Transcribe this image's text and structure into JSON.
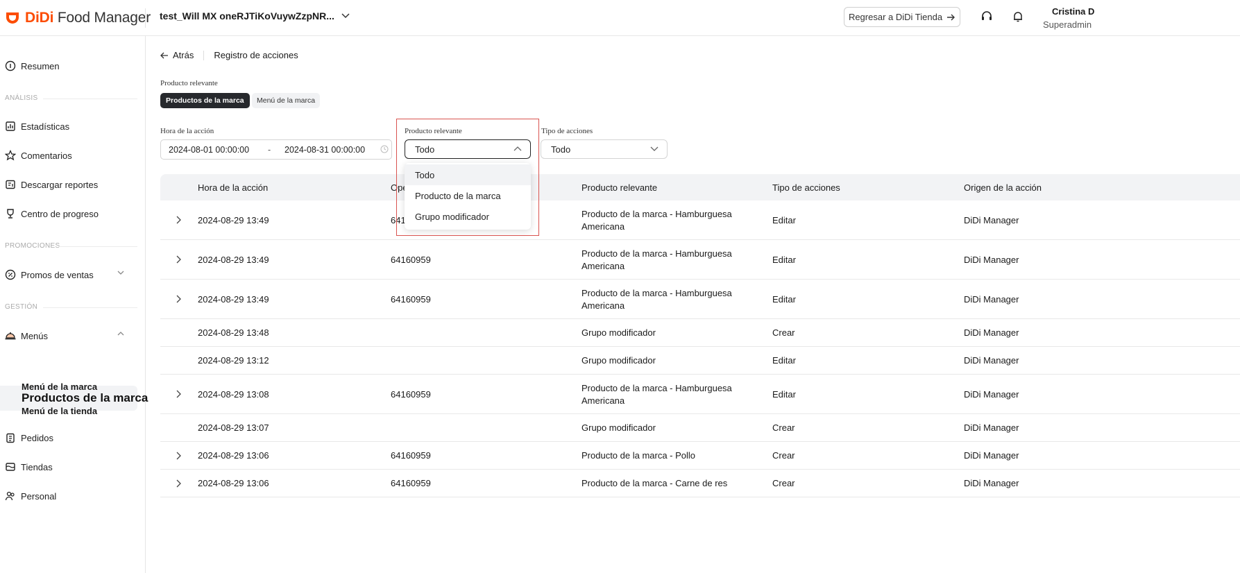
{
  "header": {
    "logo_brand": "DiDi",
    "logo_rest": " Food Manager",
    "store_name": "test_Will MX oneRJTiKoVuywZzpNR...",
    "back_button": "Regresar a DiDi Tienda",
    "user_name": "Cristina D",
    "user_role": "Superadmin"
  },
  "sidebar": {
    "resumen": "Resumen",
    "section_analisis": "ANÁLISIS",
    "estadisticas": "Estadísticas",
    "comentarios": "Comentarios",
    "descargar": "Descargar reportes",
    "centro": "Centro de progreso",
    "section_promociones": "PROMOCIONES",
    "promos": "Promos de ventas",
    "section_gestion": "GESTIÓN",
    "menus": "Menús",
    "productos_marca": "Productos de la marca",
    "menu_marca": "Menú de la marca",
    "menu_tienda": "Menú de la tienda",
    "pedidos": "Pedidos",
    "tiendas": "Tiendas",
    "personal": "Personal"
  },
  "breadcrumb": {
    "back": "Atrás",
    "current": "Registro de acciones"
  },
  "filters": {
    "producto_label": "Producto relevante",
    "seg_on": "Productos de la marca",
    "seg_off": "Menú de la marca",
    "hora_label": "Hora de la acción",
    "date_start": "2024-08-01 00:00:00",
    "date_sep": "-",
    "date_end": "2024-08-31 00:00:00",
    "producto_select_label": "Producto relevante",
    "producto_value": "Todo",
    "tipo_label": "Tipo de acciones",
    "tipo_value": "Todo"
  },
  "dropdown": {
    "options": [
      "Todo",
      "Producto de la marca",
      "Grupo modificador"
    ]
  },
  "table": {
    "columns": [
      "Hora de la acción",
      "Ope",
      "Producto relevante",
      "Tipo de acciones",
      "Origen de la acción"
    ],
    "rows": [
      {
        "time": "2024-08-29 13:49",
        "op": "641",
        "prod1": "Producto de la marca - Hamburguesa",
        "prod2": "Americana",
        "tipo": "Editar",
        "origen": "DiDi Manager"
      },
      {
        "time": "2024-08-29 13:49",
        "op": "64160959",
        "prod1": "Producto de la marca - Hamburguesa",
        "prod2": "Americana",
        "tipo": "Editar",
        "origen": "DiDi Manager"
      },
      {
        "time": "2024-08-29 13:49",
        "op": "64160959",
        "prod1": "Producto de la marca - Hamburguesa",
        "prod2": "Americana",
        "tipo": "Editar",
        "origen": "DiDi Manager"
      },
      {
        "time": "2024-08-29 13:48",
        "op": "",
        "prod1": "Grupo modificador",
        "prod2": "",
        "tipo": "Crear",
        "origen": "DiDi Manager"
      },
      {
        "time": "2024-08-29 13:12",
        "op": "",
        "prod1": "Grupo modificador",
        "prod2": "",
        "tipo": "Editar",
        "origen": "DiDi Manager"
      },
      {
        "time": "2024-08-29 13:08",
        "op": "64160959",
        "prod1": "Producto de la marca - Hamburguesa",
        "prod2": "Americana",
        "tipo": "Editar",
        "origen": "DiDi Manager"
      },
      {
        "time": "2024-08-29 13:07",
        "op": "",
        "prod1": "Grupo modificador",
        "prod2": "",
        "tipo": "Crear",
        "origen": "DiDi Manager"
      },
      {
        "time": "2024-08-29 13:06",
        "op": "64160959",
        "prod1": "Producto de la marca - Pollo",
        "prod2": "",
        "tipo": "Crear",
        "origen": "DiDi Manager"
      },
      {
        "time": "2024-08-29 13:06",
        "op": "64160959",
        "prod1": "Producto de la marca - Carne de res",
        "prod2": "",
        "tipo": "Crear",
        "origen": "DiDi Manager"
      }
    ]
  },
  "colors": {
    "brand": "#fc4c02",
    "highlight": "#d9534f",
    "dark": "#27292d"
  }
}
